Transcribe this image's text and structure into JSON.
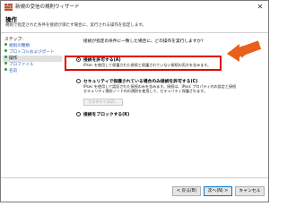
{
  "window": {
    "title": "新規の受信の規則ウィザード",
    "close_glyph": "✕"
  },
  "header": {
    "title": "操作",
    "description": "規則で指定された条件を接続が満たす場合に、実行される操作を指定します。"
  },
  "sidebar": {
    "steps_label": "ステップ:",
    "items": [
      {
        "label": "規則の種類"
      },
      {
        "label": "プロトコルおよびポート"
      },
      {
        "label": "操作"
      },
      {
        "label": "プロファイル"
      },
      {
        "label": "名前"
      }
    ],
    "active_index": 2
  },
  "content": {
    "question": "接続が指定の条件に一致した場合に、どの操作を実行しますか?",
    "options": [
      {
        "label": "接続を許可する(A)",
        "description": "IPsec を使用して保護された接続と保護されていない接続の両方を含みます。",
        "selected": true
      },
      {
        "label": "セキュリティで保護されている場合のみ接続を許可する(C)",
        "description_line1": "IPsec を使用して認証された接続のみを含みます。接続は、IPsec プロパティ内の設定と接続",
        "description_line2": "セキュリティ規則ノード内の規則を使用して、セキュリティ保護されます。",
        "customize_label": "カスタマイズ(Z)...",
        "selected": false
      },
      {
        "label": "接続をブロックする(K)",
        "selected": false
      }
    ]
  },
  "footer": {
    "back_label": "< 戻る(B)",
    "next_label": "次へ(N) >",
    "cancel_label": "キャンセル"
  },
  "annotations": {
    "highlight_color": "#e00000",
    "arrow_color": "#e8601c"
  }
}
